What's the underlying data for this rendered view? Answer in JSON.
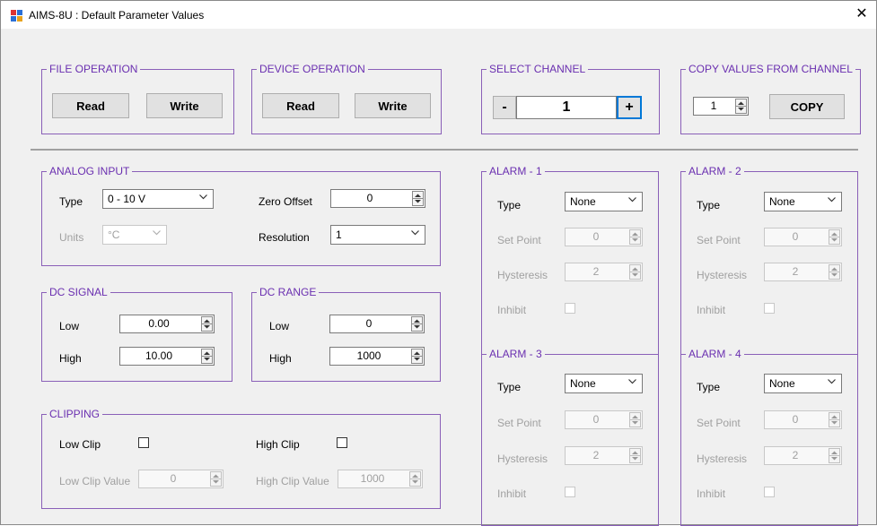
{
  "window": {
    "title": "AIMS-8U : Default Parameter Values",
    "close_glyph": "✕"
  },
  "file_operation": {
    "title": "FILE OPERATION",
    "read": "Read",
    "write": "Write"
  },
  "device_operation": {
    "title": "DEVICE OPERATION",
    "read": "Read",
    "write": "Write"
  },
  "select_channel": {
    "title": "SELECT CHANNEL",
    "minus": "-",
    "value": "1",
    "plus": "+"
  },
  "copy_values": {
    "title": "COPY VALUES FROM CHANNEL",
    "value": "1",
    "copy": "COPY"
  },
  "analog_input": {
    "title": "ANALOG INPUT",
    "type_label": "Type",
    "type_value": "0 - 10 V",
    "units_label": "Units",
    "units_value": "°C",
    "zero_offset_label": "Zero Offset",
    "zero_offset_value": "0",
    "resolution_label": "Resolution",
    "resolution_value": "1"
  },
  "dc_signal": {
    "title": "DC SIGNAL",
    "low_label": "Low",
    "low_value": "0.00",
    "high_label": "High",
    "high_value": "10.00"
  },
  "dc_range": {
    "title": "DC RANGE",
    "low_label": "Low",
    "low_value": "0",
    "high_label": "High",
    "high_value": "1000"
  },
  "clipping": {
    "title": "CLIPPING",
    "low_clip_label": "Low Clip",
    "high_clip_label": "High Clip",
    "low_clip_value_label": "Low Clip Value",
    "low_clip_value": "0",
    "high_clip_value_label": "High Clip Value",
    "high_clip_value": "1000"
  },
  "alarms": [
    {
      "title": "ALARM - 1",
      "type_label": "Type",
      "type_value": "None",
      "set_point_label": "Set Point",
      "set_point": "0",
      "hysteresis_label": "Hysteresis",
      "hysteresis": "2",
      "inhibit_label": "Inhibit"
    },
    {
      "title": "ALARM - 2",
      "type_label": "Type",
      "type_value": "None",
      "set_point_label": "Set Point",
      "set_point": "0",
      "hysteresis_label": "Hysteresis",
      "hysteresis": "2",
      "inhibit_label": "Inhibit"
    },
    {
      "title": "ALARM - 3",
      "type_label": "Type",
      "type_value": "None",
      "set_point_label": "Set Point",
      "set_point": "0",
      "hysteresis_label": "Hysteresis",
      "hysteresis": "2",
      "inhibit_label": "Inhibit"
    },
    {
      "title": "ALARM - 4",
      "type_label": "Type",
      "type_value": "None",
      "set_point_label": "Set Point",
      "set_point": "0",
      "hysteresis_label": "Hysteresis",
      "hysteresis": "2",
      "inhibit_label": "Inhibit"
    }
  ],
  "colors": {
    "group_border": "#8a5fb8",
    "group_title": "#6a2fb0",
    "focus_border": "#0078d7",
    "disabled_text": "#a0a0a0"
  }
}
